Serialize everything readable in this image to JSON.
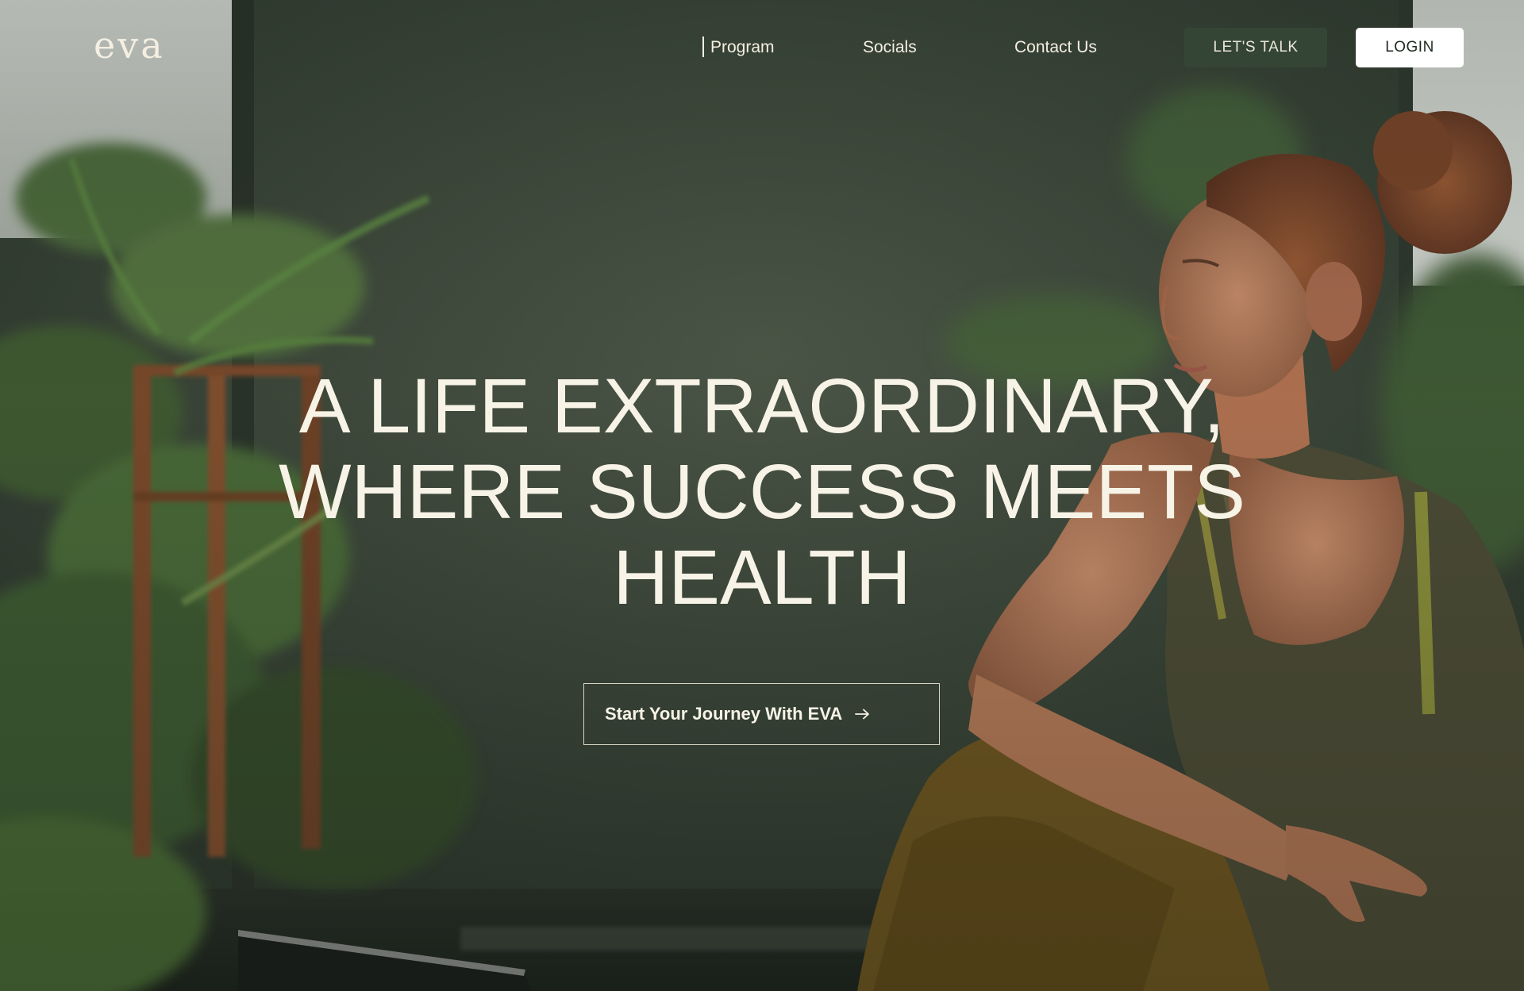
{
  "brand": {
    "logo_text": "eva"
  },
  "nav": {
    "items": [
      {
        "label": "Program"
      },
      {
        "label": "Socials"
      },
      {
        "label": "Contact Us"
      }
    ],
    "lets_talk_label": "LET'S TALK",
    "login_label": "LOGIN"
  },
  "hero": {
    "headline_lines": [
      "A LIFE EXTRAORDINARY,",
      "WHERE SUCCESS MEETS",
      "HEALTH"
    ],
    "cta_label": "Start Your Journey With EVA",
    "cta_icon": "arrow-right-icon",
    "background_image": "woman-seated-among-plants-photo"
  },
  "colors": {
    "text_light": "#f7f3e6",
    "button_dark": "#344536",
    "button_light": "#ffffff",
    "background": "#3a4536"
  }
}
